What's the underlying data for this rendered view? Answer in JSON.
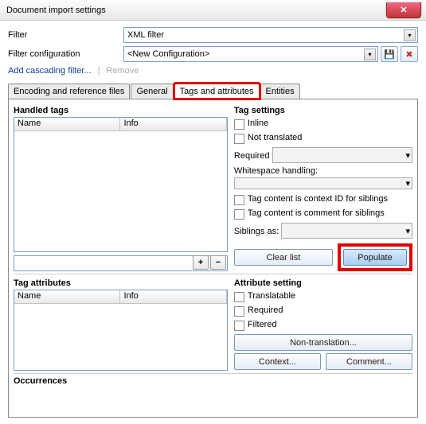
{
  "window": {
    "title": "Document import settings"
  },
  "filter": {
    "label": "Filter",
    "value": "XML filter"
  },
  "filter_config": {
    "label": "Filter configuration",
    "value": "<New Configuration>"
  },
  "links": {
    "add_cascading": "Add cascading filter...",
    "remove": "Remove"
  },
  "tabs": [
    {
      "id": "encoding",
      "label": "Encoding and reference files"
    },
    {
      "id": "general",
      "label": "General"
    },
    {
      "id": "tags",
      "label": "Tags and attributes"
    },
    {
      "id": "entities",
      "label": "Entities"
    }
  ],
  "handled_tags": {
    "title": "Handled tags",
    "cols": [
      "Name",
      "Info"
    ]
  },
  "tag_settings": {
    "title": "Tag settings",
    "inline": "Inline",
    "not_translated": "Not translated",
    "required": "Required",
    "whitespace": "Whitespace handling:",
    "context_id": "Tag content is context ID for siblings",
    "comment": "Tag content is comment for siblings",
    "siblings_as": "Siblings as:",
    "clear_list": "Clear list",
    "populate": "Populate"
  },
  "tag_attributes": {
    "title": "Tag attributes",
    "cols": [
      "Name",
      "Info"
    ]
  },
  "attr_settings": {
    "title": "Attribute setting",
    "translatable": "Translatable",
    "required": "Required",
    "filtered": "Filtered",
    "non_translation": "Non-translation...",
    "context": "Context...",
    "comment": "Comment..."
  },
  "occurrences": {
    "title": "Occurrences"
  },
  "icons": {
    "save": "💾",
    "delete": "✖",
    "plus": "+",
    "minus": "−",
    "down": "▾",
    "close": "✕"
  }
}
